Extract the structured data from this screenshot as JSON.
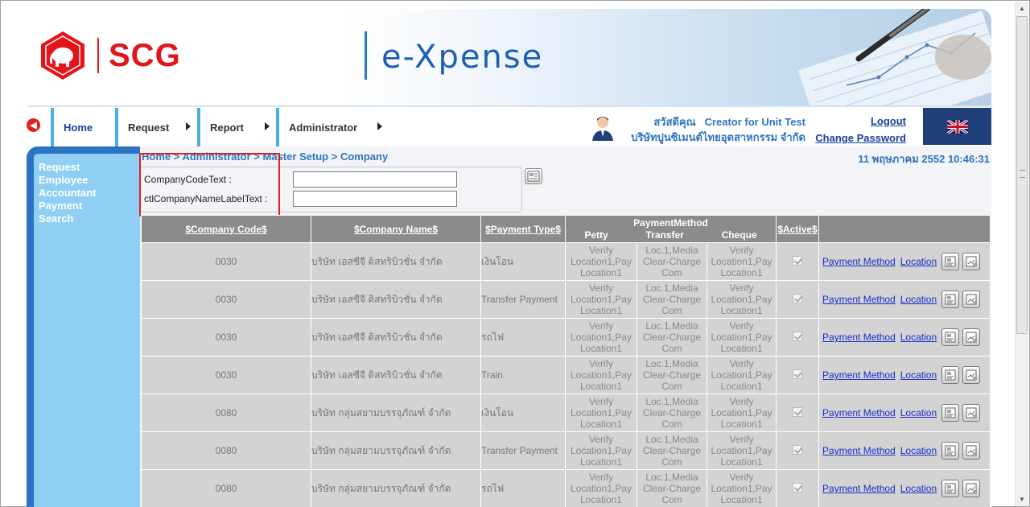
{
  "header": {
    "logo_text": "SCG",
    "app_title": "e-Xpense"
  },
  "nav": {
    "items": [
      {
        "label": "Home"
      },
      {
        "label": "Request"
      },
      {
        "label": "Report"
      },
      {
        "label": "Administrator"
      }
    ]
  },
  "user": {
    "greeting": "สวัสดีคุณ",
    "name": "Creator for Unit Test",
    "company": "บริษัทปูนซิเมนต์ไทยอุตสาหกรรม จำกัด",
    "logout": "Logout",
    "change_password": "Change Password"
  },
  "sidebar": {
    "items": [
      "Request",
      "Employee",
      "Accountant",
      "Payment",
      "Search"
    ]
  },
  "page": {
    "breadcrumb": "Home > Administrator > Master Setup > Company",
    "datetime": "11 พฤษภาคม 2552 10:46:31"
  },
  "search": {
    "company_code_label": "CompanyCodeText :",
    "company_code_value": "",
    "company_name_label": "ctlCompanyNameLabelText :",
    "company_name_value": ""
  },
  "table": {
    "headers": {
      "company_code": "$Company Code$",
      "company_name": "$Company Name$",
      "payment_type": "$Payment Type$",
      "payment_method": "PaymentMethod",
      "petty": "Petty",
      "transfer": "Transfer",
      "cheque": "Cheque",
      "active": "$Active$"
    },
    "link_payment_method": "Payment Method",
    "link_location": "Location",
    "rows": [
      {
        "code": "0030",
        "name": "บริษัท เอสซีจี ดิสทริบิวชั่น จำกัด",
        "ptype": "เงินโอน",
        "petty": [
          "Verify",
          "Location1,Pay",
          "Location1"
        ],
        "transfer": [
          "Loc.1,Media",
          "Clear-Charge",
          "Com"
        ],
        "cheque": [
          "Verify",
          "Location1,Pay",
          "Location1"
        ],
        "active": true
      },
      {
        "code": "0030",
        "name": "บริษัท เอสซีจี ดิสทริบิวชั่น จำกัด",
        "ptype": "Transfer Payment",
        "petty": [
          "Verify",
          "Location1,Pay",
          "Location1"
        ],
        "transfer": [
          "Loc.1,Media",
          "Clear-Charge",
          "Com"
        ],
        "cheque": [
          "Verify",
          "Location1,Pay",
          "Location1"
        ],
        "active": true
      },
      {
        "code": "0030",
        "name": "บริษัท เอสซีจี ดิสทริบิวชั่น จำกัด",
        "ptype": "รถไฟ",
        "petty": [
          "Verify",
          "Location1,Pay",
          "Location1"
        ],
        "transfer": [
          "Loc.1,Media",
          "Clear-Charge",
          "Com"
        ],
        "cheque": [
          "Verify",
          "Location1,Pay",
          "Location1"
        ],
        "active": true
      },
      {
        "code": "0030",
        "name": "บริษัท เอสซีจี ดิสทริบิวชั่น จำกัด",
        "ptype": "Train",
        "petty": [
          "Verify",
          "Location1,Pay",
          "Location1"
        ],
        "transfer": [
          "Loc.1,Media",
          "Clear-Charge",
          "Com"
        ],
        "cheque": [
          "Verify",
          "Location1,Pay",
          "Location1"
        ],
        "active": true
      },
      {
        "code": "0080",
        "name": "บริษัท กลุ่มสยามบรรจุภัณฑ์ จำกัด",
        "ptype": "เงินโอน",
        "petty": [
          "Verify",
          "Location1,Pay",
          "Location1"
        ],
        "transfer": [
          "Loc.1,Media",
          "Clear-Charge",
          "Com"
        ],
        "cheque": [
          "Verify",
          "Location1,Pay",
          "Location1"
        ],
        "active": true
      },
      {
        "code": "0080",
        "name": "บริษัท กลุ่มสยามบรรจุภัณฑ์ จำกัด",
        "ptype": "Transfer Payment",
        "petty": [
          "Verify",
          "Location1,Pay",
          "Location1"
        ],
        "transfer": [
          "Loc.1,Media",
          "Clear-Charge",
          "Com"
        ],
        "cheque": [
          "Verify",
          "Location1,Pay",
          "Location1"
        ],
        "active": true
      },
      {
        "code": "0080",
        "name": "บริษัท กลุ่มสยามบรรจุภัณฑ์ จำกัด",
        "ptype": "รถไฟ",
        "petty": [
          "Verify",
          "Location1,Pay",
          "Location1"
        ],
        "transfer": [
          "Loc.1,Media",
          "Clear-Charge",
          "Com"
        ],
        "cheque": [
          "Verify",
          "Location1,Pay",
          "Location1"
        ],
        "active": true
      }
    ]
  },
  "colors": {
    "brand_red": "#e4141b",
    "nav_accent": "#4aaee8",
    "sidebar_bg": "#8fcff4",
    "sidebar_border": "#2c73c5",
    "link_blue": "#2f74c0",
    "table_header": "#8b8b8b",
    "table_cell": "#d3d3d3"
  }
}
